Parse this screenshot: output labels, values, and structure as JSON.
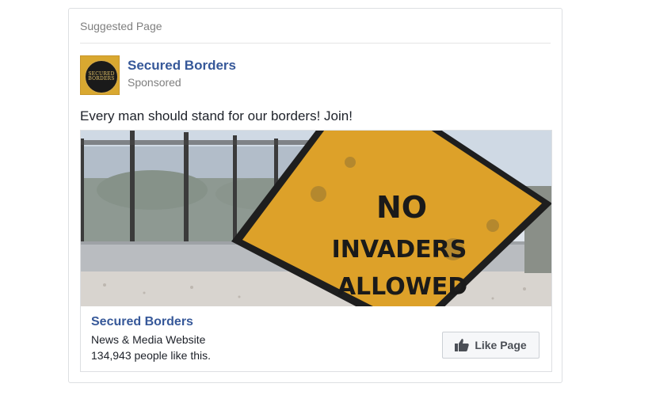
{
  "card": {
    "header": "Suggested Page"
  },
  "page": {
    "name": "Secured Borders",
    "sponsored_label": "Sponsored",
    "avatar_text": "SECURED BORDERS"
  },
  "post": {
    "text": "Every man should stand for our borders! Join!"
  },
  "ad": {
    "sign_text": [
      "NO",
      "INVADERS",
      "ALLOWED"
    ],
    "name": "Secured Borders",
    "category": "News & Media Website",
    "likes": "134,943 people like this.",
    "like_button_label": "Like Page",
    "like_icon": "thumbs-up-icon"
  },
  "colors": {
    "link_blue": "#365899",
    "muted_gray": "#7f7f7f",
    "sign_yellow": "#e5a92d"
  }
}
